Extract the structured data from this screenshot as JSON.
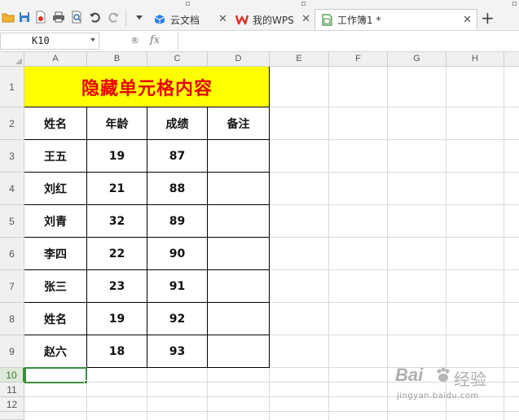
{
  "tabs": [
    {
      "label": "云文档",
      "icon": "cloud-doc-icon",
      "active": false
    },
    {
      "label": "我的WPS",
      "icon": "wps-logo-icon",
      "active": false
    },
    {
      "label": "工作簿1 *",
      "icon": "workbook-icon",
      "active": true
    }
  ],
  "formula_bar": {
    "name_box": "K10",
    "fx_label": "fx",
    "formula": ""
  },
  "columns": [
    "A",
    "B",
    "C",
    "D",
    "E",
    "F",
    "G",
    "H"
  ],
  "rows": [
    "1",
    "2",
    "3",
    "4",
    "5",
    "6",
    "7",
    "8",
    "9",
    "10",
    "11",
    "12"
  ],
  "selected_row": "10",
  "sheet": {
    "title": "隐藏单元格内容",
    "headers": [
      "姓名",
      "年龄",
      "成绩",
      "备注"
    ],
    "records": [
      [
        "王五",
        "19",
        "87",
        ""
      ],
      [
        "刘红",
        "21",
        "88",
        ""
      ],
      [
        "刘青",
        "32",
        "89",
        ""
      ],
      [
        "李四",
        "22",
        "90",
        ""
      ],
      [
        "张三",
        "23",
        "91",
        ""
      ],
      [
        "姓名",
        "19",
        "92",
        ""
      ],
      [
        "赵六",
        "18",
        "93",
        ""
      ]
    ]
  },
  "colors": {
    "title_fill": "#ffff00",
    "title_text": "#e60000",
    "selection": "#3a8d3f"
  },
  "watermark": {
    "brand": "Bai",
    "brand_suffix": "经验",
    "url": "jingyan.baidu.com"
  }
}
